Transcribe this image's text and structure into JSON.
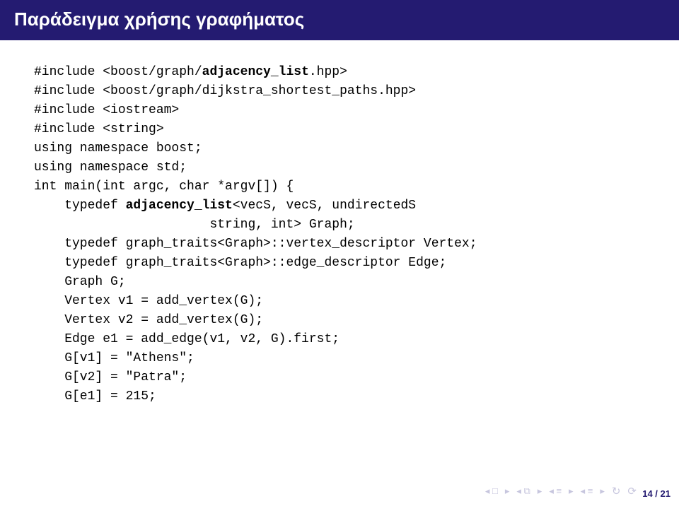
{
  "header": {
    "title": "Παράδειγμα χρήσης γραφήματος"
  },
  "code": {
    "l1a": "#include <boost/graph/",
    "l1b": "adjacency_list",
    "l1c": ".hpp>",
    "l2": "#include <boost/graph/dijkstra_shortest_paths.hpp>",
    "l3": "#include <iostream>",
    "l4": "#include <string>",
    "l5": "using namespace boost;",
    "l6": "using namespace std;",
    "l7": "",
    "l8": "int main(int argc, char *argv[]) {",
    "l9a": "    typedef ",
    "l9b": "adjacency_list",
    "l9c": "<vecS, vecS, undirectedS",
    "l10": "                       string, int> Graph;",
    "l11": "    typedef graph_traits<Graph>::vertex_descriptor Vertex;",
    "l12": "    typedef graph_traits<Graph>::edge_descriptor Edge;",
    "l13": "    Graph G;",
    "l14": "    Vertex v1 = add_vertex(G);",
    "l15": "    Vertex v2 = add_vertex(G);",
    "l16": "    Edge e1 = add_edge(v1, v2, G).first;",
    "l17": "    G[v1] = \"Athens\";",
    "l18": "    G[v2] = \"Patra\";",
    "l19": "    G[e1] = 215;"
  },
  "footer": {
    "page": "14 / 21"
  }
}
